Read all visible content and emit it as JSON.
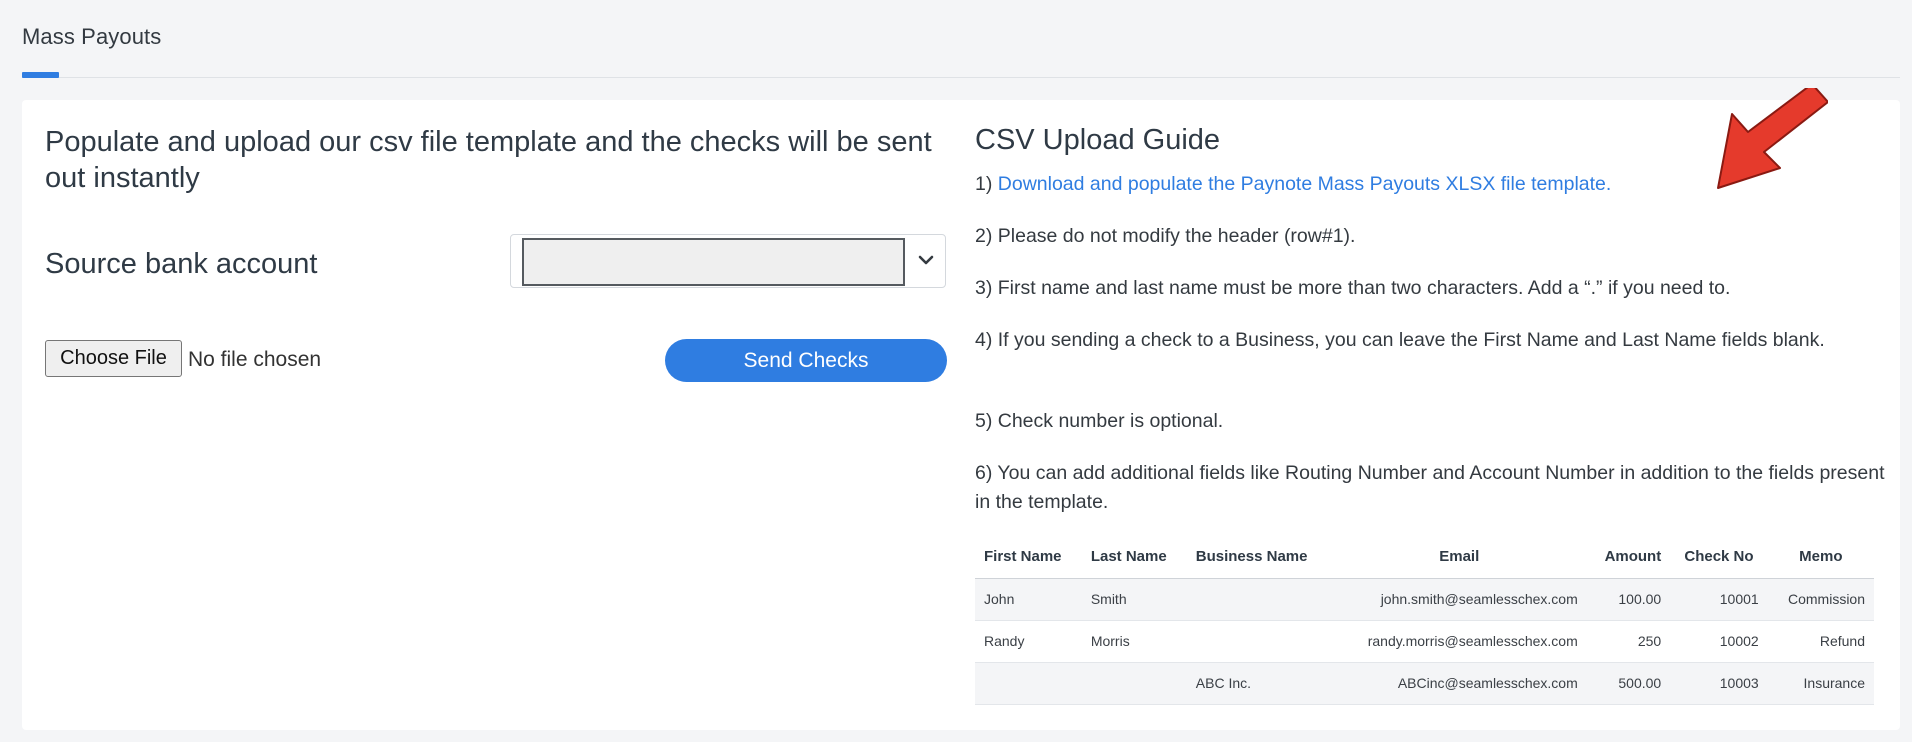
{
  "tabs": [
    {
      "label": "Mass Payouts",
      "active": true
    }
  ],
  "left": {
    "heading": "Populate and upload our csv file template and the checks will be sent out instantly",
    "source_label": "Source bank account",
    "select_value": "",
    "choose_file_label": "Choose File",
    "no_file_text": "No file chosen",
    "send_button": "Send Checks"
  },
  "guide": {
    "title": "CSV Upload Guide",
    "step1_prefix": "1) ",
    "step1_link": "Download and populate the Paynote Mass Payouts XLSX file template.",
    "step2": "2) Please do not modify the header (row#1).",
    "step3": "3) First name and last name must be more than two characters. Add a “.” if you need to.",
    "step4": "4) If you sending a check to a Business, you can leave the First Name and Last Name fields blank.",
    "step5": "5) Check number is optional.",
    "step6": "6) You can add additional fields like Routing Number and Account Number in addition to the fields present in the template."
  },
  "table": {
    "headers": [
      "First Name",
      "Last Name",
      "Business Name",
      "Email",
      "Amount",
      "Check No",
      "Memo"
    ],
    "rows": [
      [
        "John",
        "Smith",
        "",
        "john.smith@seamlesschex.com",
        "100.00",
        "10001",
        "Commission"
      ],
      [
        "Randy",
        "Morris",
        "",
        "randy.morris@seamlesschex.com",
        "250",
        "10002",
        "Refund"
      ],
      [
        "",
        "",
        "ABC Inc.",
        "ABCinc@seamlesschex.com",
        "500.00",
        "10003",
        "Insurance"
      ]
    ]
  },
  "colors": {
    "accent": "#2f7de1",
    "arrow": "#e53a2c"
  }
}
